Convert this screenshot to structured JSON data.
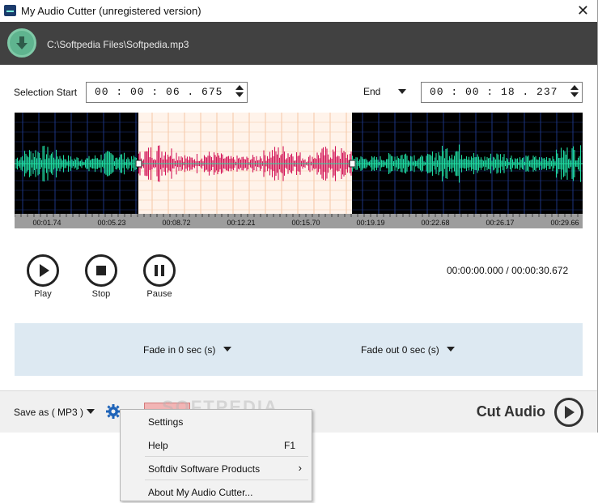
{
  "window": {
    "title": "My Audio Cutter (unregistered version)",
    "close_glyph": "✕"
  },
  "file": {
    "path": "C:\\Softpedia Files\\Softpedia.mp3",
    "icon": "download-icon"
  },
  "selection": {
    "start_label": "Selection Start",
    "start_value": "00 : 00 : 06 . 675",
    "end_label": "End",
    "end_value": "00 : 00 : 18 . 237"
  },
  "waveform": {
    "timeline": [
      "00:01.74",
      "00:05.23",
      "00:08.72",
      "00:12.21",
      "00:15.70",
      "00:19.19",
      "00:22.68",
      "00:26.17",
      "00:29.66"
    ],
    "selection_start_fraction": 0.2176,
    "selection_end_fraction": 0.5943,
    "colors": {
      "background": "#000000",
      "unselected_wave": "#1fd9a0",
      "selected_bg": "#fff3ea",
      "selected_wave": "#d3185a",
      "grid": "#1c3580"
    }
  },
  "controls": {
    "play_label": "Play",
    "stop_label": "Stop",
    "pause_label": "Pause",
    "position_readout": "00:00:00.000 / 00:00:30.672"
  },
  "fade": {
    "fade_in": "Fade in 0 sec (s)",
    "fade_out": "Fade out 0 sec (s)"
  },
  "bottom": {
    "save_as": "Save as ( MP3 )",
    "cut_label": "Cut Audio",
    "watermark": "SOFTPEDIA"
  },
  "context_menu": {
    "items": [
      {
        "label": "Settings",
        "shortcut": ""
      },
      {
        "label": "Help",
        "shortcut": "F1"
      },
      {
        "label": "Softdiv Software Products",
        "shortcut": ""
      },
      {
        "label": "About My Audio Cutter...",
        "shortcut": ""
      }
    ],
    "submenu_glyph": "›"
  }
}
